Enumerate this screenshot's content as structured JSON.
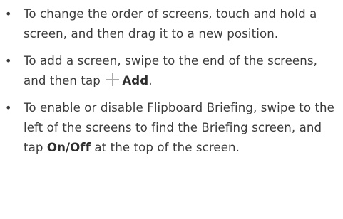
{
  "bullets": [
    {
      "marker": "•",
      "text": "To change the order of screens, touch and hold a screen, and then drag it to a new position."
    },
    {
      "marker": "•",
      "text_before": "To add a screen, swipe to the end of the screens, and then tap",
      "icon": "plus-icon",
      "bold_label": "Add",
      "text_after": "."
    },
    {
      "marker": "•",
      "text_before": "To enable or disable Flipboard Briefing, swipe to the left of the screens to find the Briefing screen, and tap",
      "bold_label": "On/Off",
      "text_after": "at the top of the screen."
    }
  ],
  "colors": {
    "text": "#3a3a3a",
    "icon": "#a8a8a8"
  }
}
